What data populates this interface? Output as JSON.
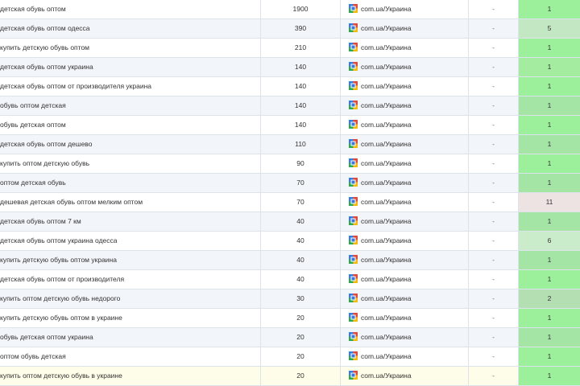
{
  "colors": {
    "pos_top": "#a6f2a6",
    "pos_top_alt": "#b1ecb1",
    "pos_mid": "#c6e8c6",
    "pos_low": "#f0e6e6"
  },
  "rows": [
    {
      "keyword": "детская обувь оптом",
      "volume": "1900",
      "engine": "com.ua/Украина",
      "dash": "-",
      "position": "1",
      "pos_color": "#9cf09c"
    },
    {
      "keyword": "детская обувь оптом одесса",
      "volume": "390",
      "engine": "com.ua/Украина",
      "dash": "-",
      "position": "5",
      "pos_color": "#c3e6c3"
    },
    {
      "keyword": "купить детскую обувь оптом",
      "volume": "210",
      "engine": "com.ua/Украина",
      "dash": "-",
      "position": "1",
      "pos_color": "#9cf09c"
    },
    {
      "keyword": "детская обувь оптом украина",
      "volume": "140",
      "engine": "com.ua/Украина",
      "dash": "-",
      "position": "1",
      "pos_color": "#a4ec9f"
    },
    {
      "keyword": "детская обувь оптом от производителя украина",
      "volume": "140",
      "engine": "com.ua/Украина",
      "dash": "-",
      "position": "1",
      "pos_color": "#9cf09c"
    },
    {
      "keyword": "обувь оптом детская",
      "volume": "140",
      "engine": "com.ua/Украина",
      "dash": "-",
      "position": "1",
      "pos_color": "#a4e4a4"
    },
    {
      "keyword": "обувь детская оптом",
      "volume": "140",
      "engine": "com.ua/Украина",
      "dash": "-",
      "position": "1",
      "pos_color": "#9cf09c"
    },
    {
      "keyword": "детская обувь оптом дешево",
      "volume": "110",
      "engine": "com.ua/Украина",
      "dash": "-",
      "position": "1",
      "pos_color": "#a4e4a4"
    },
    {
      "keyword": "купить оптом детскую обувь",
      "volume": "90",
      "engine": "com.ua/Украина",
      "dash": "-",
      "position": "1",
      "pos_color": "#9cf09c"
    },
    {
      "keyword": "оптом детская обувь",
      "volume": "70",
      "engine": "com.ua/Украина",
      "dash": "-",
      "position": "1",
      "pos_color": "#a4e4a4"
    },
    {
      "keyword": "дешевая детская обувь оптом мелким оптом",
      "volume": "70",
      "engine": "com.ua/Украина",
      "dash": "-",
      "position": "11",
      "pos_color": "#ede3e3"
    },
    {
      "keyword": "детская обувь оптом 7 км",
      "volume": "40",
      "engine": "com.ua/Украина",
      "dash": "-",
      "position": "1",
      "pos_color": "#a4e4a4"
    },
    {
      "keyword": "детская обувь оптом украина одесса",
      "volume": "40",
      "engine": "com.ua/Украина",
      "dash": "-",
      "position": "6",
      "pos_color": "#cbeccb"
    },
    {
      "keyword": "купить детскую обувь оптом украина",
      "volume": "40",
      "engine": "com.ua/Украина",
      "dash": "-",
      "position": "1",
      "pos_color": "#a4e4a4"
    },
    {
      "keyword": "детская обувь оптом от производителя",
      "volume": "40",
      "engine": "com.ua/Украина",
      "dash": "-",
      "position": "1",
      "pos_color": "#9cf09c"
    },
    {
      "keyword": "купить оптом детскую обувь недорого",
      "volume": "30",
      "engine": "com.ua/Украина",
      "dash": "-",
      "position": "2",
      "pos_color": "#b3dfb3"
    },
    {
      "keyword": "купить детскую обувь оптом в украине",
      "volume": "20",
      "engine": "com.ua/Украина",
      "dash": "-",
      "position": "1",
      "pos_color": "#9cf09c"
    },
    {
      "keyword": "обувь детская оптом украина",
      "volume": "20",
      "engine": "com.ua/Украина",
      "dash": "-",
      "position": "1",
      "pos_color": "#a4e4a4"
    },
    {
      "keyword": "оптом обувь детская",
      "volume": "20",
      "engine": "com.ua/Украина",
      "dash": "-",
      "position": "1",
      "pos_color": "#9cf09c"
    },
    {
      "keyword": "купить оптом детскую обувь в украине",
      "volume": "20",
      "engine": "com.ua/Украина",
      "dash": "-",
      "position": "1",
      "pos_color": "#9cf09c"
    }
  ]
}
